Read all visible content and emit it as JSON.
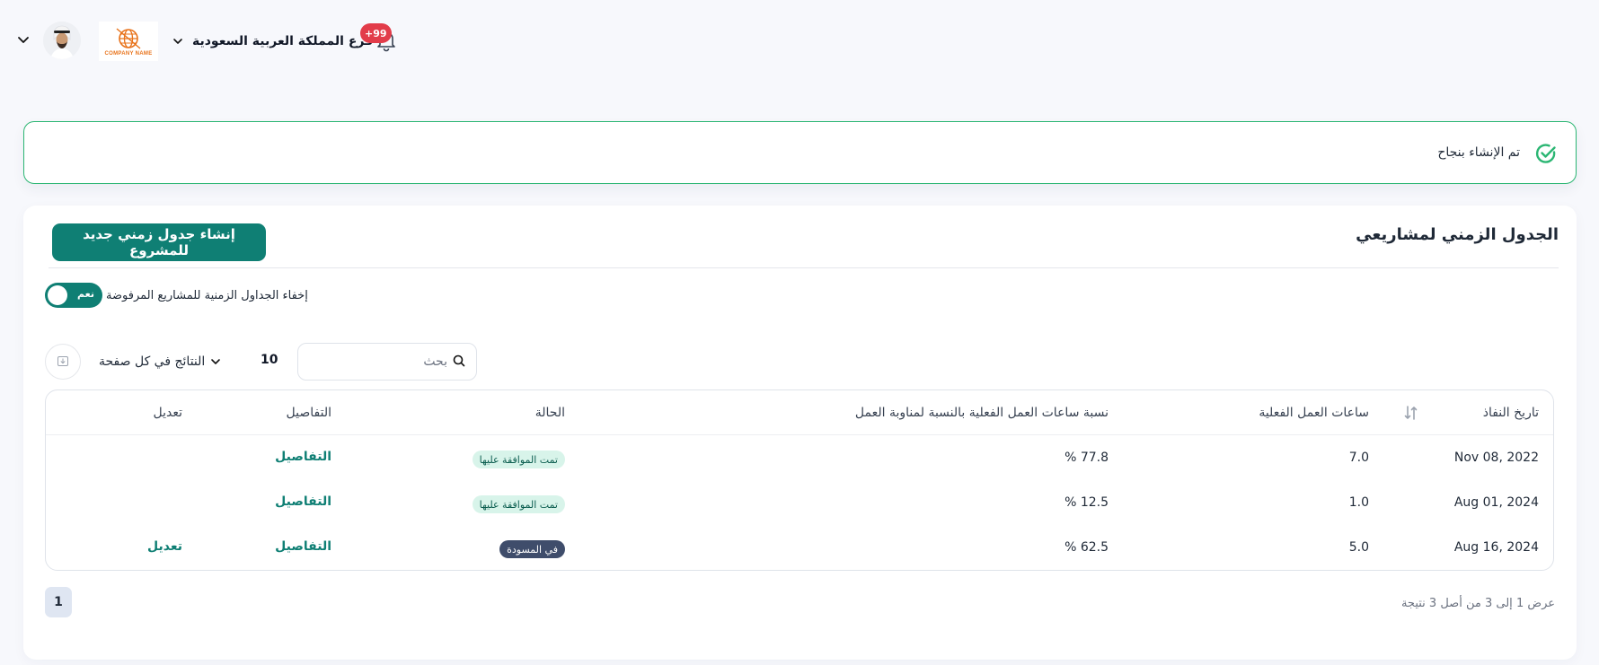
{
  "header": {
    "branch_label": "فرع المملكة العربية السعودية",
    "notifications_badge": "+99",
    "company_logo_text": "COMPANY NAME"
  },
  "alert": {
    "message": "تم الإنشاء بنجاح"
  },
  "main": {
    "title": "الجدول الزمني لمشاريعي",
    "create_button": "إنشاء جدول زمني جديد للمشروع",
    "toggle_label": "إخفاء الجداول الزمنية للمشاريع المرفوضة",
    "toggle_value": "نعم",
    "per_page_label": "النتائج في كل صفحة",
    "per_page_value": "10",
    "search_placeholder": "بحث"
  },
  "table": {
    "headers": {
      "effective_date": "تاريخ النفاذ",
      "actual_hours": "ساعات العمل الفعلية",
      "ratio": "نسبة ساعات العمل الفعلية بالنسبة لمناوبة العمل",
      "status": "الحالة",
      "details": "التفاصيل",
      "edit": "تعديل"
    },
    "rows": [
      {
        "date": "Nov 08, 2022",
        "hours": "7.0",
        "ratio": "% 77.8",
        "status": "تمت الموافقة عليها",
        "details": "التفاصيل",
        "edit": ""
      },
      {
        "date": "Aug 01, 2024",
        "hours": "1.0",
        "ratio": "% 12.5",
        "status": "تمت الموافقة عليها",
        "details": "التفاصيل",
        "edit": ""
      },
      {
        "date": "Aug 16, 2024",
        "hours": "5.0",
        "ratio": "% 62.5",
        "status": "في المسودة",
        "details": "التفاصيل",
        "edit": "تعديل"
      }
    ]
  },
  "pagination": {
    "current_page": "1",
    "summary": "عرض 1 إلى 3 من أصل 3 نتيجة"
  },
  "colors": {
    "brand": "#0f7f74",
    "success_border": "#2bb673",
    "badge_red": "#e23c4a",
    "draft_badge": "#3f4d6b"
  }
}
